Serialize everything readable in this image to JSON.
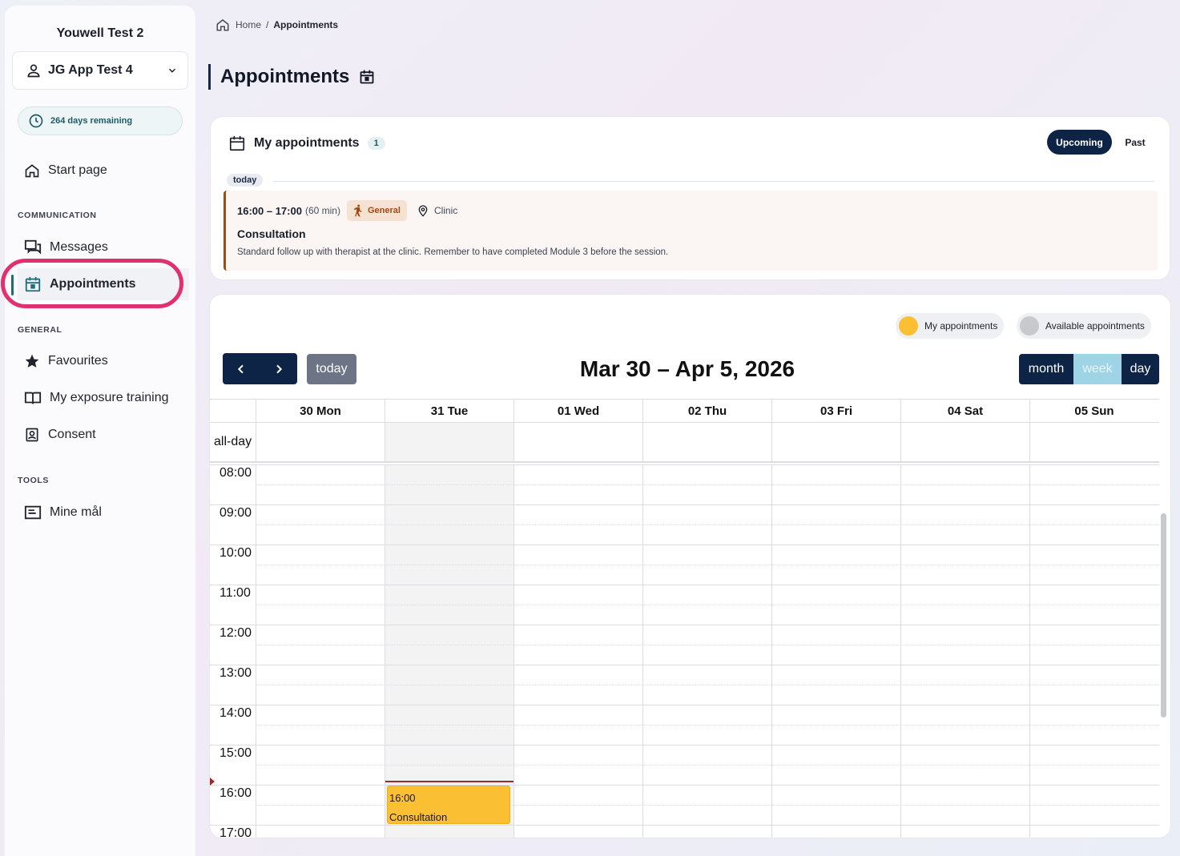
{
  "sidebar": {
    "org_name": "Youwell Test 2",
    "user_name": "JG App Test 4",
    "days_remaining": "264 days remaining",
    "start_page": "Start page",
    "sections": {
      "communication": "COMMUNICATION",
      "general": "GENERAL",
      "tools": "TOOLS"
    },
    "items": {
      "messages": "Messages",
      "appointments": "Appointments",
      "favourites": "Favourites",
      "exposure": "My exposure training",
      "consent": "Consent",
      "mine_mal": "Mine mål"
    },
    "highlight_color": "#e0306f"
  },
  "breadcrumb": {
    "home": "Home",
    "sep": "/",
    "current": "Appointments"
  },
  "page_title": "Appointments",
  "my_appointments": {
    "title": "My appointments",
    "count": "1",
    "toggle_upcoming": "Upcoming",
    "toggle_past": "Past",
    "today_chip": "today",
    "entry": {
      "time": "16:00 – 17:00",
      "duration": "(60 min)",
      "category": "General",
      "location": "Clinic",
      "title": "Consultation",
      "description": "Standard follow up with therapist at the clinic. Remember to have completed Module 3 before the session."
    }
  },
  "calendar": {
    "legend_mine": "My appointments",
    "legend_available": "Available appointments",
    "legend_mine_color": "#fbbf34",
    "legend_available_color": "#c8c9cc",
    "today_btn": "today",
    "range_title": "Mar 30 – Apr 5, 2026",
    "views": {
      "month": "month",
      "week": "week",
      "day": "day"
    },
    "active_view": "week",
    "all_day": "all-day",
    "days": [
      "30 Mon",
      "31 Tue",
      "01 Wed",
      "02 Thu",
      "03 Fri",
      "04 Sat",
      "05 Sun"
    ],
    "times": [
      "08:00",
      "09:00",
      "10:00",
      "11:00",
      "12:00",
      "13:00",
      "14:00",
      "15:00",
      "16:00",
      "17:00"
    ],
    "event": {
      "time": "16:00",
      "title": "Consultation"
    },
    "accent_color": "#0d2447"
  }
}
